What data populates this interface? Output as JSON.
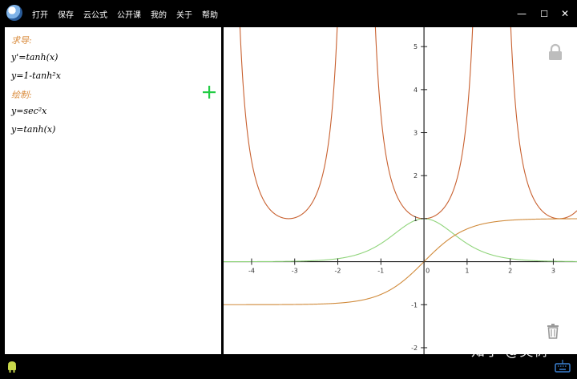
{
  "menu": [
    "打开",
    "保存",
    "云公式",
    "公开课",
    "我的",
    "关于",
    "帮助"
  ],
  "window_controls": {
    "minimize": "—",
    "maximize": "☐",
    "close": "✕"
  },
  "panel": {
    "section1_label": "求导:",
    "expr1": "y'=tanh(x)",
    "expr2": "y=1-tanh²x",
    "section2_label": "绘制:",
    "expr3": "y=sec²x",
    "expr4": "y=tanh(x)"
  },
  "watermark": "知乎 @灵树",
  "icons": {
    "app": "app-logo-icon",
    "add": "plus-icon",
    "lock": "lock-icon",
    "trash": "trash-icon",
    "status": "android-icon",
    "keyboard": "keyboard-icon"
  },
  "colors": {
    "orange_curve": "#c8602f",
    "green_curve": "#8fd47a",
    "tanh_curve": "#d08a3a",
    "label_orange": "#d98a3a",
    "plus_green": "#22cc44"
  },
  "chart_data": {
    "type": "line",
    "x_ticks": [
      -4,
      -3,
      -2,
      -1,
      0,
      1,
      2,
      3
    ],
    "x_tick_labels": [
      "-4",
      "-3",
      "-2",
      "-1",
      "0",
      "1",
      "2",
      "3"
    ],
    "y_ticks": [
      -2,
      -1,
      1,
      2,
      3,
      4,
      5
    ],
    "y_tick_labels": [
      "-2",
      "-1",
      "1",
      "2",
      "3",
      "4",
      "5"
    ],
    "xlim": [
      -4.65,
      3.55
    ],
    "ylim": [
      -2.15,
      5.45
    ],
    "series": [
      {
        "expr": "y=sec²x",
        "function": "sec2",
        "color": "#c8602f"
      },
      {
        "expr": "y=1-tanh²x",
        "function": "sech2",
        "color": "#8fd47a"
      },
      {
        "expr": "y=tanh(x)",
        "function": "tanh",
        "color": "#d08a3a"
      }
    ]
  }
}
